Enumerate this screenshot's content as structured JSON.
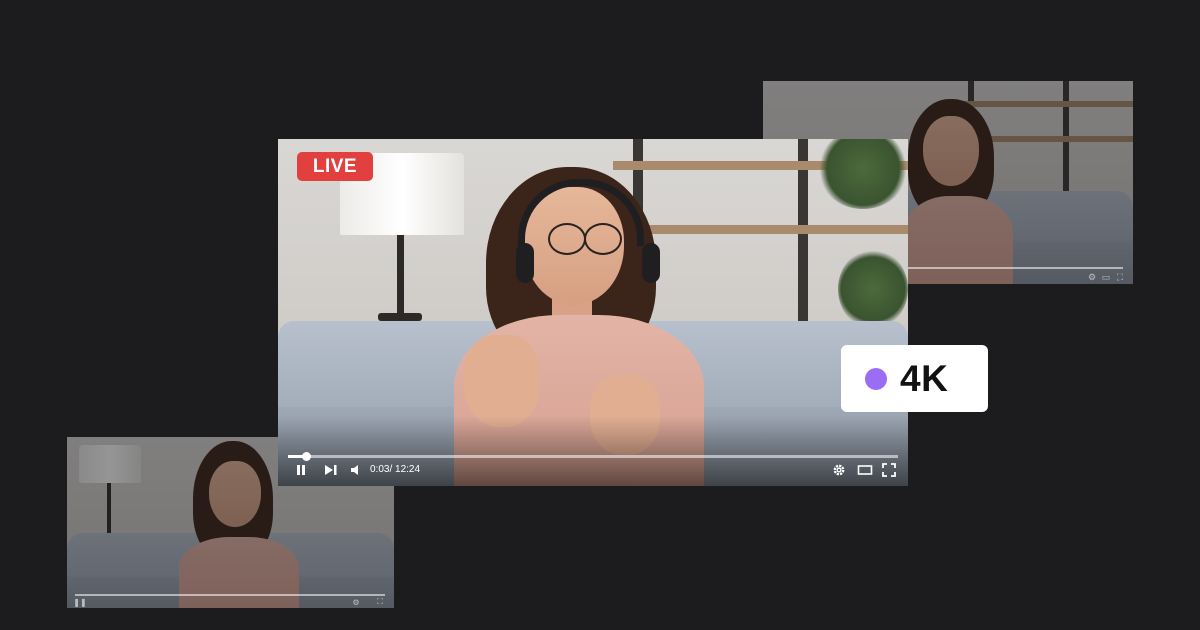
{
  "main_player": {
    "live_label": "LIVE",
    "time_display": "0:03/ 12:24",
    "progress_fraction": 0.03,
    "icons": [
      "pause-icon",
      "skip-next-icon",
      "volume-icon",
      "settings-icon",
      "theater-mode-icon",
      "fullscreen-icon"
    ]
  },
  "quality_badge": {
    "label": "4K",
    "dot_color": "#9b6cf4"
  },
  "background_players": {
    "top_right": {
      "progress_fraction": 1.0
    },
    "bottom_left": {
      "progress_fraction": 0.0
    }
  },
  "colors": {
    "background": "#1c1c1e",
    "live_badge": "#e2403f",
    "accent": "#9b6cf4"
  }
}
